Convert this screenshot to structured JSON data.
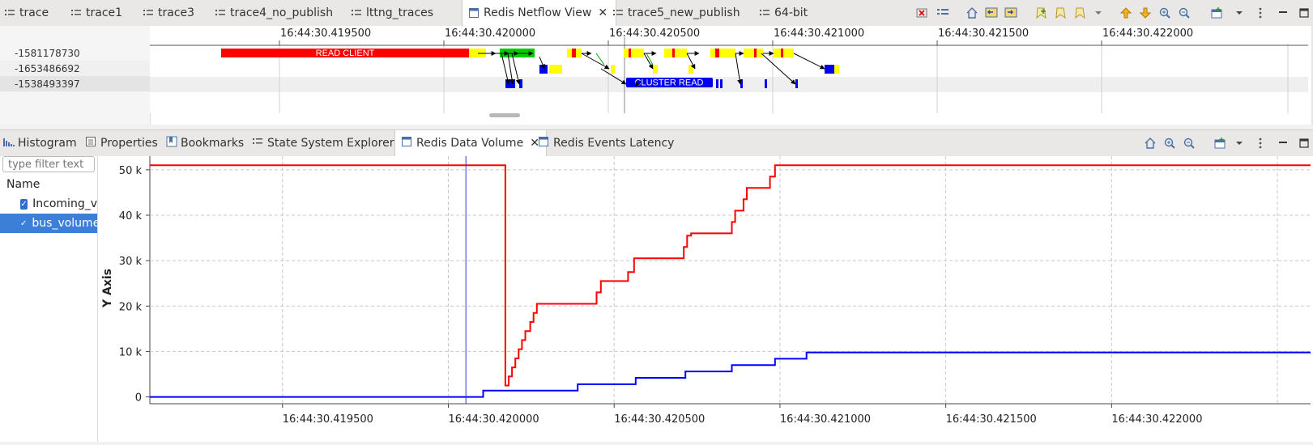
{
  "top_tabs": [
    {
      "label": "trace",
      "icon": "trace-icon"
    },
    {
      "label": "trace1",
      "icon": "trace-icon"
    },
    {
      "label": "trace3",
      "icon": "trace-icon"
    },
    {
      "label": "trace4_no_publish",
      "icon": "trace-icon"
    },
    {
      "label": "lttng_traces",
      "icon": "trace-icon"
    },
    {
      "label": "Redis Netflow View",
      "icon": "view-icon",
      "active": true,
      "close": "✕"
    },
    {
      "label": "trace5_new_publish",
      "icon": "trace-icon"
    },
    {
      "label": "64-bit",
      "icon": "trace-icon"
    }
  ],
  "netflow": {
    "time_ticks": [
      "16:44:30.419500",
      "16:44:30.420000",
      "16:44:30.420500",
      "16:44:30.421000",
      "16:44:30.421500",
      "16:44:30.422000"
    ],
    "rows": [
      "-1581178730",
      "-1653486692",
      "-1538493397"
    ],
    "read_client_label": "READ CLIENT",
    "cluster_read_label": "CLUSTER READ",
    "colors": {
      "read_client": "#ff0000",
      "cluster_read": "#0000ee",
      "state_yellow": "#ffff00",
      "state_green": "#00cc00",
      "state_blue": "#0000ee"
    }
  },
  "bottom_tabs": [
    {
      "label": "Histogram",
      "icon": "histogram-icon"
    },
    {
      "label": "Properties",
      "icon": "properties-icon"
    },
    {
      "label": "Bookmarks",
      "icon": "bookmarks-icon"
    },
    {
      "label": "State System Explorer",
      "icon": "state-system-icon"
    },
    {
      "label": "Redis Data Volume",
      "icon": "view-icon",
      "active": true,
      "close": "✕"
    },
    {
      "label": "Redis Events Latency",
      "icon": "view-icon"
    }
  ],
  "tree": {
    "filter_placeholder": "type filter text",
    "header": "Name",
    "items": [
      {
        "label": "Incoming_v",
        "checked": true
      },
      {
        "label": "bus_volume",
        "checked": true,
        "selected": true
      }
    ]
  },
  "chart_data": {
    "type": "line",
    "ylabel": "Y Axis",
    "ytick_labels": [
      "0",
      "10 k",
      "20 k",
      "30 k",
      "40 k",
      "50 k"
    ],
    "yticks": [
      0,
      10000,
      20000,
      30000,
      40000,
      50000
    ],
    "ylim": [
      -1500,
      53000
    ],
    "xtick_labels": [
      "16:44:30.419500",
      "16:44:30.420000",
      "16:44:30.420500",
      "16:44:30.421000",
      "16:44:30.421500",
      "16:44:30.422000"
    ],
    "x_unit": "microseconds after 16:44:30.419",
    "xlim": [
      100,
      3600
    ],
    "grid": true,
    "cursor_x": 1053,
    "series": [
      {
        "color": "#ff0000",
        "x": [
          100,
          1172,
          1172,
          1182,
          1182,
          1192,
          1192,
          1202,
          1202,
          1212,
          1212,
          1222,
          1222,
          1232,
          1232,
          1247,
          1247,
          1257,
          1257,
          1267,
          1267,
          1277,
          1277,
          1293,
          1293,
          1447,
          1447,
          1460,
          1460,
          1475,
          1475,
          1542,
          1542,
          1560,
          1560,
          1593,
          1593,
          1710,
          1710,
          1720,
          1720,
          1732,
          1732,
          1740,
          1740,
          1855,
          1855,
          1865,
          1865,
          1875,
          1875,
          1890,
          1890,
          1900,
          1900,
          1922,
          1922,
          1945,
          1945,
          1970,
          1970,
          1985,
          1985,
          2050,
          2050,
          2060,
          2060,
          2070,
          2070,
          2085,
          2085,
          3600
        ],
        "y": [
          51000,
          51000,
          2500,
          2500,
          4500,
          4500,
          6500,
          6500,
          8500,
          8500,
          10500,
          10500,
          12500,
          12500,
          14500,
          14500,
          16500,
          16500,
          18500,
          18500,
          20500,
          20500,
          20500,
          20500,
          20500,
          20500,
          23000,
          23000,
          25500,
          25500,
          25500,
          25500,
          27500,
          27500,
          30500,
          30500,
          30500,
          30500,
          33000,
          33000,
          35500,
          35500,
          36000,
          36000,
          36000,
          36000,
          38500,
          38500,
          41000,
          41000,
          41000,
          41000,
          43500,
          43500,
          46000,
          46000,
          46000,
          46000,
          46000,
          46000,
          48500,
          48500,
          51000,
          51000,
          51000,
          51000,
          51000,
          51000,
          51000,
          51000,
          51000,
          51000
        ]
      },
      {
        "color": "#0000ff",
        "x": [
          100,
          1105,
          1105,
          1390,
          1390,
          1565,
          1565,
          1715,
          1715,
          1855,
          1855,
          1985,
          1985,
          2080,
          2080,
          3600
        ],
        "y": [
          0,
          0,
          1400,
          1400,
          2800,
          2800,
          4200,
          4200,
          5600,
          5600,
          7000,
          7000,
          8400,
          8400,
          9800,
          9800
        ]
      }
    ]
  }
}
